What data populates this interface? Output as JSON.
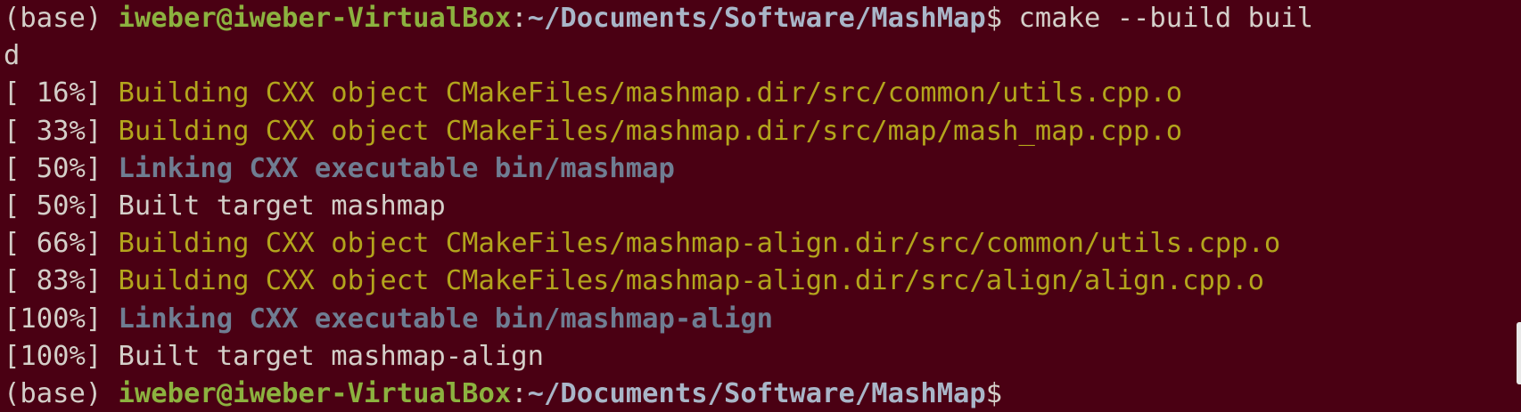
{
  "colors": {
    "background": "#4a0013",
    "text": "#d4cfc9",
    "user_host": "#8cb23f",
    "path": "#a9b6c8",
    "build_message": "#b3a51c",
    "link_message": "#6f7d92"
  },
  "prompt_1": {
    "env": "(base) ",
    "user_host": "iweber@iweber-VirtualBox",
    "separator": ":",
    "path": "~/Documents/Software/MashMap",
    "dollar": "$ ",
    "command": "cmake --build buil"
  },
  "wrap_line": "d",
  "output": [
    {
      "pct": "[ 16%] ",
      "kind": "build",
      "text": "Building CXX object CMakeFiles/mashmap.dir/src/common/utils.cpp.o"
    },
    {
      "pct": "[ 33%] ",
      "kind": "build",
      "text": "Building CXX object CMakeFiles/mashmap.dir/src/map/mash_map.cpp.o"
    },
    {
      "pct": "[ 50%] ",
      "kind": "link",
      "text": "Linking CXX executable bin/mashmap"
    },
    {
      "pct": "[ 50%] ",
      "kind": "target",
      "text": "Built target mashmap"
    },
    {
      "pct": "[ 66%] ",
      "kind": "build",
      "text": "Building CXX object CMakeFiles/mashmap-align.dir/src/common/utils.cpp.o"
    },
    {
      "pct": "[ 83%] ",
      "kind": "build",
      "text": "Building CXX object CMakeFiles/mashmap-align.dir/src/align/align.cpp.o"
    },
    {
      "pct": "[100%] ",
      "kind": "link",
      "text": "Linking CXX executable bin/mashmap-align"
    },
    {
      "pct": "[100%] ",
      "kind": "target",
      "text": "Built target mashmap-align"
    }
  ],
  "prompt_2": {
    "env": "(base) ",
    "user_host": "iweber@iweber-VirtualBox",
    "separator": ":",
    "path": "~/Documents/Software/MashMap",
    "dollar": "$"
  }
}
